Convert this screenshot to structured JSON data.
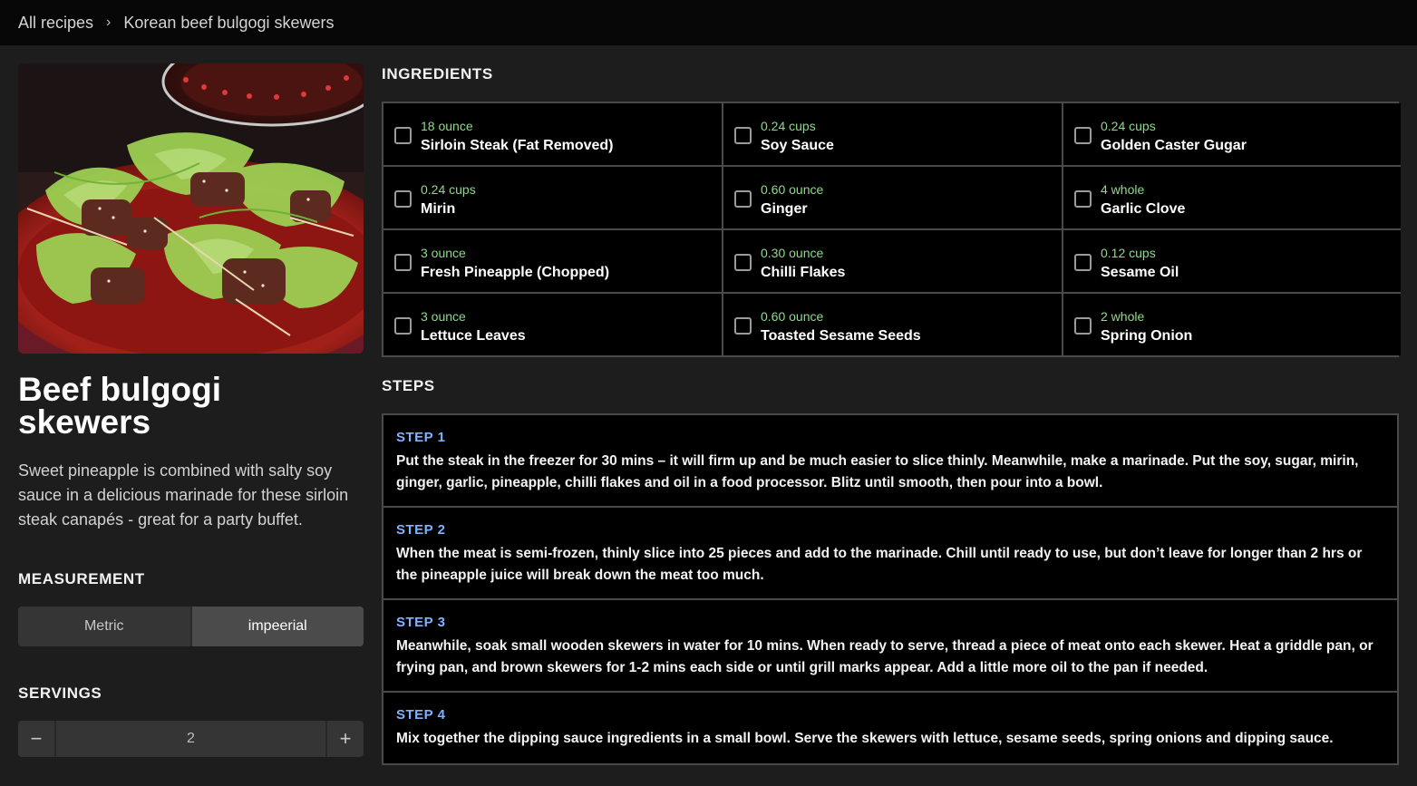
{
  "breadcrumb": {
    "root": "All recipes",
    "separator": "›",
    "current": "Korean beef bulgogi skewers"
  },
  "recipe": {
    "title": "Beef bulgogi skewers",
    "description": "Sweet pineapple is combined with salty soy sauce in a delicious marinade for these sirloin steak canapés - great for a party buffet."
  },
  "measurement": {
    "heading": "MEASUREMENT",
    "options": [
      "Metric",
      "impeerial"
    ],
    "selected": "impeerial"
  },
  "servings": {
    "heading": "SERVINGS",
    "minus": "−",
    "value": "2",
    "plus": "+"
  },
  "ingredients": {
    "heading": "INGREDIENTS",
    "items": [
      {
        "qty": "18 ounce",
        "name": "Sirloin Steak (Fat Removed)"
      },
      {
        "qty": "0.24 cups",
        "name": "Soy Sauce"
      },
      {
        "qty": "0.24 cups",
        "name": "Golden Caster Gugar"
      },
      {
        "qty": "0.24 cups",
        "name": "Mirin"
      },
      {
        "qty": "0.60 ounce",
        "name": "Ginger"
      },
      {
        "qty": "4 whole",
        "name": "Garlic Clove"
      },
      {
        "qty": "3 ounce",
        "name": "Fresh Pineapple (Chopped)"
      },
      {
        "qty": "0.30 ounce",
        "name": "Chilli Flakes"
      },
      {
        "qty": "0.12 cups",
        "name": "Sesame Oil"
      },
      {
        "qty": "3 ounce",
        "name": "Lettuce Leaves"
      },
      {
        "qty": "0.60 ounce",
        "name": "Toasted Sesame Seeds"
      },
      {
        "qty": "2 whole",
        "name": "Spring Onion"
      }
    ]
  },
  "steps": {
    "heading": "STEPS",
    "items": [
      {
        "label": "STEP 1",
        "text": "Put the steak in the freezer for 30 mins – it will firm up and be much easier to slice thinly. Meanwhile, make a marinade. Put the soy, sugar, mirin, ginger, garlic, pineapple, chilli flakes and oil in a food processor. Blitz until smooth, then pour into a bowl."
      },
      {
        "label": "STEP 2",
        "text": "When the meat is semi-frozen, thinly slice into 25 pieces and add to the marinade. Chill until ready to use, but don’t leave for longer than 2 hrs or the pineapple juice will break down the meat too much."
      },
      {
        "label": "STEP 3",
        "text": "Meanwhile, soak small wooden skewers in water for 10 mins. When ready to serve, thread a piece of meat onto each skewer. Heat a griddle pan, or frying pan, and brown skewers for 1-2 mins each side or until grill marks appear. Add a little more oil to the pan if needed."
      },
      {
        "label": "STEP 4",
        "text": "Mix together the dipping sauce ingredients in a small bowl. Serve the skewers with lettuce, sesame seeds, spring onions and dipping sauce."
      }
    ]
  },
  "colors": {
    "background": "#1d1d1d",
    "topbar": "#060606",
    "quantity_green": "#8ed98a",
    "step_blue": "#7fb2ff"
  }
}
